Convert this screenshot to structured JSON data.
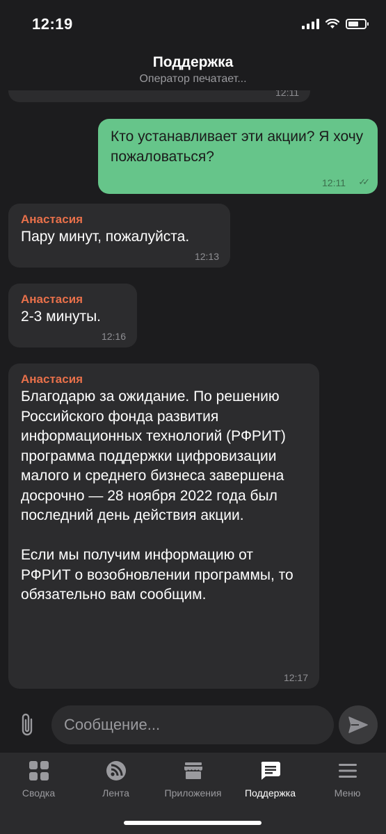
{
  "status_bar": {
    "time": "12:19"
  },
  "header": {
    "title": "Поддержка",
    "subtitle": "Оператор печатает..."
  },
  "messages": [
    {
      "direction": "in",
      "time": "12:11"
    },
    {
      "direction": "out",
      "text": "Кто устанавливает эти акции? Я хочу пожаловаться?",
      "time": "12:11",
      "status": "read"
    },
    {
      "direction": "in",
      "sender": "Анастасия",
      "text": "Пару минут, пожалуйста.",
      "time": "12:13"
    },
    {
      "direction": "in",
      "sender": "Анастасия",
      "text": "2-3 минуты.",
      "time": "12:16"
    },
    {
      "direction": "in",
      "sender": "Анастасия",
      "text": "Благодарю за ожидание. По решению Российского фонда развития информационных технологий (РФРИТ) программа поддержки цифровизации малого и среднего бизнеса завершена досрочно — 28 ноября 2022 года был последний день действия акции.\n\nЕсли мы получим информацию от РФРИТ о возобновлении программы, то обязательно вам сообщим.",
      "time": "12:17"
    }
  ],
  "composer": {
    "placeholder": "Сообщение...",
    "attach_icon": "paperclip-icon",
    "send_icon": "send-icon"
  },
  "tabs": [
    {
      "label": "Сводка",
      "icon": "grid-icon",
      "active": false
    },
    {
      "label": "Лента",
      "icon": "feed-icon",
      "active": false
    },
    {
      "label": "Приложения",
      "icon": "store-icon",
      "active": false
    },
    {
      "label": "Поддержка",
      "icon": "chat-icon",
      "active": true
    },
    {
      "label": "Меню",
      "icon": "menu-icon",
      "active": false
    }
  ],
  "colors": {
    "background": "#1c1c1e",
    "bubble_in": "#2c2c2e",
    "bubble_out": "#66c58a",
    "sender": "#e8704a",
    "tab_bar": "#2b2b2d"
  }
}
